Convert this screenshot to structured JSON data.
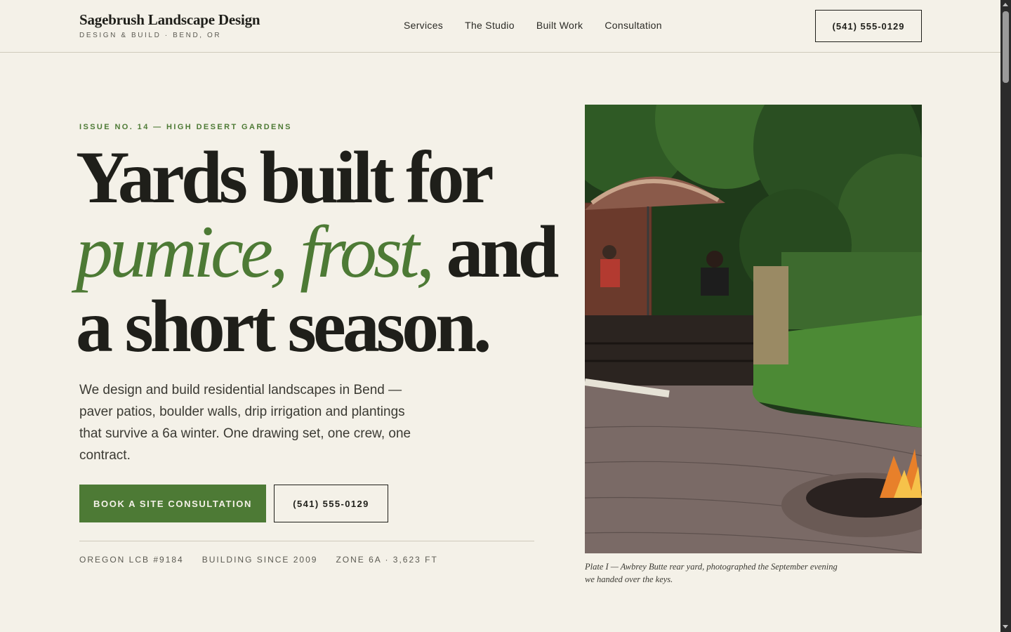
{
  "header": {
    "brand_name": "Sagebrush Landscape Design",
    "brand_tagline": "DESIGN & BUILD · BEND, OR",
    "nav": [
      "Services",
      "The Studio",
      "Built Work",
      "Consultation"
    ],
    "phone_button": "(541) 555-0129"
  },
  "hero": {
    "eyebrow": "ISSUE NO. 14 — HIGH DESERT GARDENS",
    "headline_line1": "Yards built for",
    "headline_accent": "pumice, frost,",
    "headline_line2_rest": " and",
    "headline_line3": "a short season.",
    "intro": "We design and build residential landscapes in Bend — paver patios, boulder walls, drip irrigation and plantings that survive a 6a winter. One drawing set, one crew, one contract.",
    "primary_cta": "BOOK A SITE CONSULTATION",
    "secondary_cta": "(541) 555-0129",
    "credentials": [
      "OREGON LCB #9184",
      "BUILDING SINCE 2009",
      "ZONE 6A · 3,623 FT"
    ]
  },
  "photo": {
    "caption": "Plate I — Awbrey Butte rear yard, photographed the September evening we handed over the keys."
  },
  "colors": {
    "background": "#f4f1e8",
    "accent_green": "#4d7a35",
    "ink": "#1f1f1a"
  }
}
